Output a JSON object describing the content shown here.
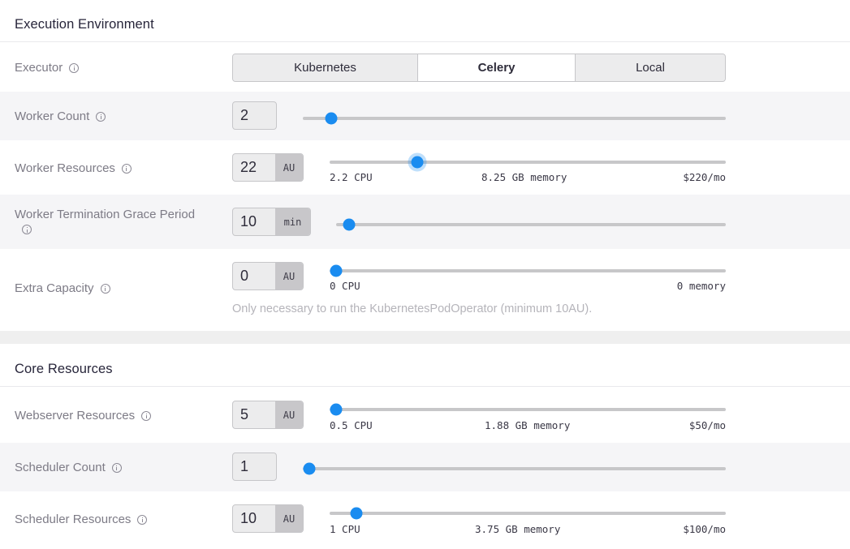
{
  "execution": {
    "title": "Execution Environment",
    "executor": {
      "label": "Executor",
      "options": [
        "Kubernetes",
        "Celery",
        "Local"
      ],
      "selected": "Celery"
    },
    "worker_count": {
      "label": "Worker Count",
      "value": "2",
      "slider_fraction": 0.07
    },
    "worker_resources": {
      "label": "Worker Resources",
      "value": "22",
      "unit": "AU",
      "cpu": "2.2 CPU",
      "memory": "8.25 GB memory",
      "cost": "$220/mo",
      "slider_fraction": 0.22
    },
    "grace_period": {
      "label": "Worker Termination Grace Period",
      "value": "10",
      "unit": "min",
      "slider_fraction": 0.03
    },
    "extra_capacity": {
      "label": "Extra Capacity",
      "value": "0",
      "unit": "AU",
      "cpu": "0 CPU",
      "memory": "0 memory",
      "slider_fraction": 0.0,
      "help": "Only necessary to run the KubernetesPodOperator (minimum 10AU)."
    }
  },
  "core": {
    "title": "Core Resources",
    "webserver_resources": {
      "label": "Webserver Resources",
      "value": "5",
      "unit": "AU",
      "cpu": "0.5 CPU",
      "memory": "1.88 GB memory",
      "cost": "$50/mo",
      "slider_fraction": 0.0
    },
    "scheduler_count": {
      "label": "Scheduler Count",
      "value": "1",
      "slider_fraction": 0.0
    },
    "scheduler_resources": {
      "label": "Scheduler Resources",
      "value": "10",
      "unit": "AU",
      "cpu": "1 CPU",
      "memory": "3.75 GB memory",
      "cost": "$100/mo",
      "slider_fraction": 0.05
    }
  },
  "colors": {
    "accent": "#1a8cf0",
    "track": "#c7c7c9",
    "row_alt": "#f5f5f7"
  },
  "icons": {
    "info": "info-circle-icon"
  }
}
